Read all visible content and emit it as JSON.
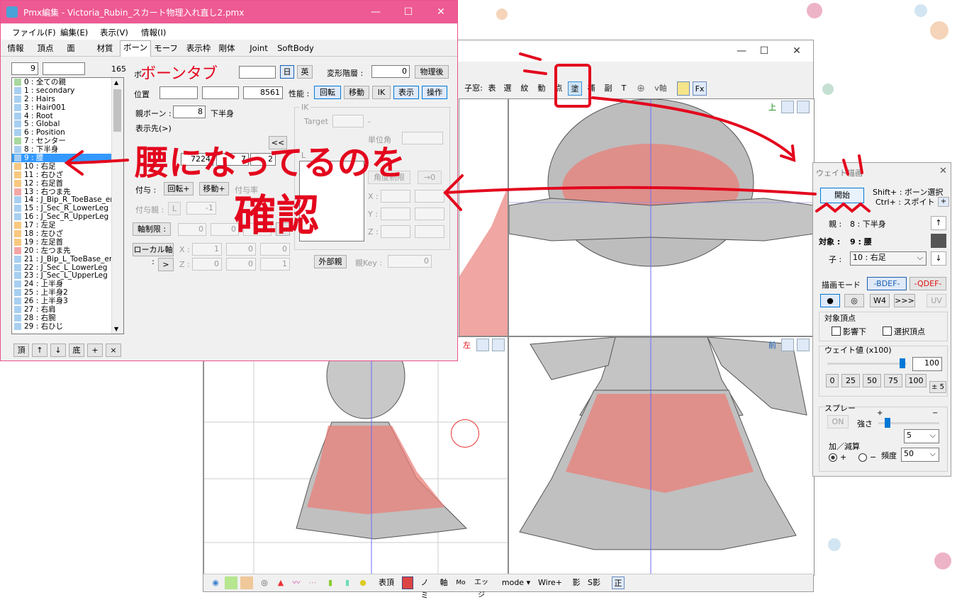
{
  "pmx_window": {
    "title": "Pmx編集 - Victoria_Rubin_スカート物理入れ直し2.pmx",
    "menu": [
      "ファイル(F)",
      "編集(E)",
      "表示(V)",
      "情報(I)"
    ],
    "tabs": [
      "情報",
      "頂点",
      "面",
      "材質",
      "ボーン",
      "モーフ",
      "表示枠",
      "剛体",
      "Joint",
      "SoftBody"
    ],
    "active_tab": "ボーン",
    "index_value": "9",
    "count": "165",
    "bones": [
      {
        "label": "0 : 全ての親",
        "color": "#a8d8a0"
      },
      {
        "label": "1 : secondary",
        "color": "#a8cff0"
      },
      {
        "label": "2 : Hairs",
        "color": "#a8cff0"
      },
      {
        "label": "3 : Hair001",
        "color": "#a8cff0"
      },
      {
        "label": "4 : Root",
        "color": "#a8cff0"
      },
      {
        "label": "5 : Global",
        "color": "#a8cff0"
      },
      {
        "label": "6 : Position",
        "color": "#a8cff0"
      },
      {
        "label": "7 : センター",
        "color": "#a8d8a0"
      },
      {
        "label": "8 : 下半身",
        "color": "#a8cff0"
      },
      {
        "label": "9 : 腰",
        "color": "#a8cff0"
      },
      {
        "label": "10 : 右足",
        "color": "#f8c880"
      },
      {
        "label": "11 : 右ひざ",
        "color": "#f8c880"
      },
      {
        "label": "12 : 右足首",
        "color": "#f8c880"
      },
      {
        "label": "13 : 右つま先",
        "color": "#f4a6a6"
      },
      {
        "label": "14 : J_Bip_R_ToeBase_en",
        "color": "#a8cff0"
      },
      {
        "label": "15 : J_Sec_R_LowerLeg",
        "color": "#a8cff0"
      },
      {
        "label": "16 : J_Sec_R_UpperLeg",
        "color": "#a8cff0"
      },
      {
        "label": "17 : 左足",
        "color": "#f8c880"
      },
      {
        "label": "18 : 左ひざ",
        "color": "#f8c880"
      },
      {
        "label": "19 : 左足首",
        "color": "#f8c880"
      },
      {
        "label": "20 : 左つま先",
        "color": "#f4a6a6"
      },
      {
        "label": "21 : J_Bip_L_ToeBase_en",
        "color": "#a8cff0"
      },
      {
        "label": "22 : J_Sec_L_LowerLeg",
        "color": "#a8cff0"
      },
      {
        "label": "23 : J_Sec_L_UpperLeg",
        "color": "#a8cff0"
      },
      {
        "label": "24 : 上半身",
        "color": "#a8cff0"
      },
      {
        "label": "25 : 上半身2",
        "color": "#a8cff0"
      },
      {
        "label": "26 : 上半身3",
        "color": "#a8cff0"
      },
      {
        "label": "27 : 右肩",
        "color": "#a8cff0"
      },
      {
        "label": "28 : 右腕",
        "color": "#a8cff0"
      },
      {
        "label": "29 : 右ひじ",
        "color": "#a8cff0"
      }
    ],
    "selected_bone_index": 9,
    "list_buttons": [
      "頂",
      "↑",
      "↓",
      "底",
      "+",
      "×"
    ],
    "props": {
      "bone_label": "ボ",
      "lang_buttons": [
        "日",
        "英"
      ],
      "deform_layer_label": "変形階層 :",
      "deform_layer_value": "0",
      "after_physics": "物理後",
      "position_label": "位置",
      "position_z": "8561",
      "performance_label": "性能 :",
      "perf_buttons": [
        "回転",
        "移動",
        "IK",
        "表示",
        "操作"
      ],
      "parent_label": "親ボーン :",
      "parent_value": "8",
      "parent_name": "下半身",
      "display_to_label": "表示先(>)",
      "display_btn": "<<",
      "disp_val_a": "7224",
      "disp_val_b": "7",
      "disp_val_c": "2",
      "ik_group": "IK",
      "ik_target": "Target",
      "ik_dash": "-",
      "ik_unit_angle": "単位角",
      "ik_link_label": "L",
      "angle_limit": "角度制限",
      "arrow_zero": "→0",
      "ik_x": "X :",
      "ik_y": "Y :",
      "ik_z": "Z :",
      "grant_label": "付与 :",
      "grant_rot": "回転+",
      "grant_move": "移動+",
      "grant_rate": "付与率",
      "grant_parent_label": "付与親 :",
      "grant_parent_btn": "L",
      "grant_parent_value": "-1",
      "axis_limit": "軸制限 :",
      "axis_values": [
        "0",
        "0"
      ],
      "axis_more": ">",
      "local_axis": "ローカル軸 :",
      "local_x_label": "X :",
      "local_x": [
        "1",
        "0",
        "0"
      ],
      "local_z_label": "Z :",
      "local_z": [
        "0",
        "0",
        "1"
      ],
      "local_more": ">",
      "external_parent": "外部親",
      "parent_key_label": "親Key :",
      "parent_key_value": "0"
    }
  },
  "viewer": {
    "toolbar": [
      "子窓:",
      "表",
      "選",
      "紋",
      "動",
      "点",
      "塗",
      "補",
      "副",
      "T",
      "v軸",
      "Fx"
    ],
    "viewport_labels": {
      "top": "上",
      "left": "左",
      "front": "前"
    },
    "bottom_items": [
      "表頂",
      "ノミ",
      "軸",
      "Mo",
      "エッジ",
      "mode",
      "Wire+",
      "影",
      "S影",
      "正"
    ]
  },
  "weight_panel": {
    "title": "ウェイト描画",
    "start_button": "開始",
    "shift_hint": "Shift+ : ボーン選択",
    "ctrl_hint": "Ctrl+ : スポイト",
    "plus_btn": "+",
    "parent_label": "親 :",
    "parent_value": "8 : 下半身",
    "target_label": "対象 :",
    "target_value": "9 : 腰",
    "child_label": "子 :",
    "child_value": "10 : 右足",
    "draw_mode_label": "描画モード",
    "bdef": "-BDEF-",
    "qdef": "-QDEF-",
    "mode_buttons": [
      "●",
      "◎",
      "W4",
      ">>>",
      "UV"
    ],
    "target_vertex_label": "対象頂点",
    "influence": "影響下",
    "selected_vertex": "選択頂点",
    "weight_label": "ウェイト値 (x100)",
    "weight_value": "100",
    "weight_fill": 0.95,
    "quick_values": [
      "0",
      "25",
      "50",
      "75",
      "100"
    ],
    "pm5": "± 5",
    "spray_label": "スプレー",
    "spray_on": "ON",
    "strength_label": "強さ",
    "plus": "+",
    "minus": "−",
    "strength_fill": 0.15,
    "strength_value": "5",
    "add_sub_label": "加／減算",
    "radio_plus": "+",
    "radio_minus": "−",
    "freq_label": "頻度",
    "freq_value": "50"
  },
  "annotations": {
    "bone_tab_note": "ボーンタブ",
    "confirm_line1": "腰になってるのを",
    "confirm_line2": "確認",
    "quote_mark": "〃",
    "colors": {
      "ink": "#e3061d"
    }
  }
}
